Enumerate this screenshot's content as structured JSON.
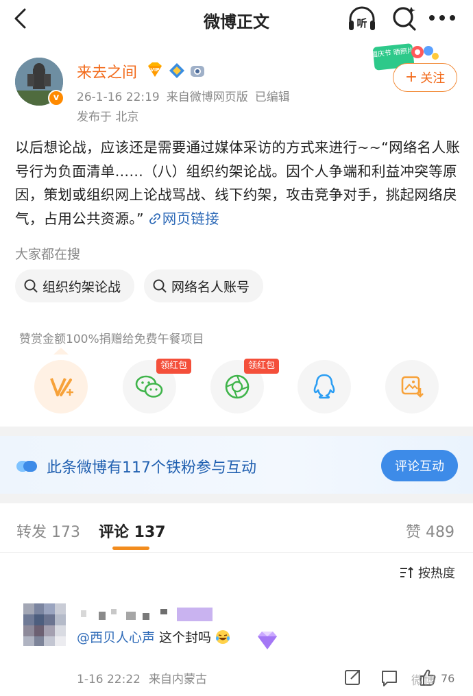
{
  "nav": {
    "title": "微博正文",
    "listen_label": "听"
  },
  "post": {
    "username": "来去之间",
    "avatar_badge": "v",
    "time": "26-1-16 22:19",
    "source": "来自微博网页版",
    "edited": "已编辑",
    "location": "发布于 北京",
    "follow_label": "关注",
    "promo_text": "国庆节 晒照片",
    "text": "以后想论战，应该还是需要通过媒体采访的方式来进行~~“网络名人账号行为负面清单……（八）组织约架论战。因个人争端和利益冲突等原因，策划或组织网上论战骂战、线下约架，攻击竞争对手，挑起网络戾气，占用公共资源。”",
    "link_text": "网页链接"
  },
  "hot_search": {
    "label": "大家都在搜",
    "chips": [
      "组织约架论战",
      "网络名人账号"
    ]
  },
  "reward": {
    "text": "赞赏金额100%捐赠给免费午餐项目"
  },
  "share": {
    "items": [
      {
        "name": "vplus",
        "icon": "v-plus-icon"
      },
      {
        "name": "wechat",
        "icon": "wechat-icon",
        "tag": "领红包"
      },
      {
        "name": "moments",
        "icon": "moments-icon",
        "tag": "领红包"
      },
      {
        "name": "qq",
        "icon": "qq-icon"
      },
      {
        "name": "save-image",
        "icon": "save-image-icon"
      }
    ]
  },
  "fans_banner": {
    "text": "此条微博有117个铁粉参与互动",
    "button": "评论互动"
  },
  "tabs": {
    "repost": "转发 173",
    "comment": "评论 137",
    "like": "赞 489"
  },
  "sort": {
    "label": "按热度"
  },
  "comment": {
    "mention": "@西贝人心声",
    "text": " 这个封吗",
    "time": "1-16 22:22",
    "source": "来自内蒙古",
    "like_count": "76"
  },
  "watermark": "微博",
  "colors": {
    "accent_orange": "#f26a1a",
    "link_blue": "#2f6bb8",
    "banner_blue": "#3d8be8",
    "red_tag": "#f44f3a"
  }
}
